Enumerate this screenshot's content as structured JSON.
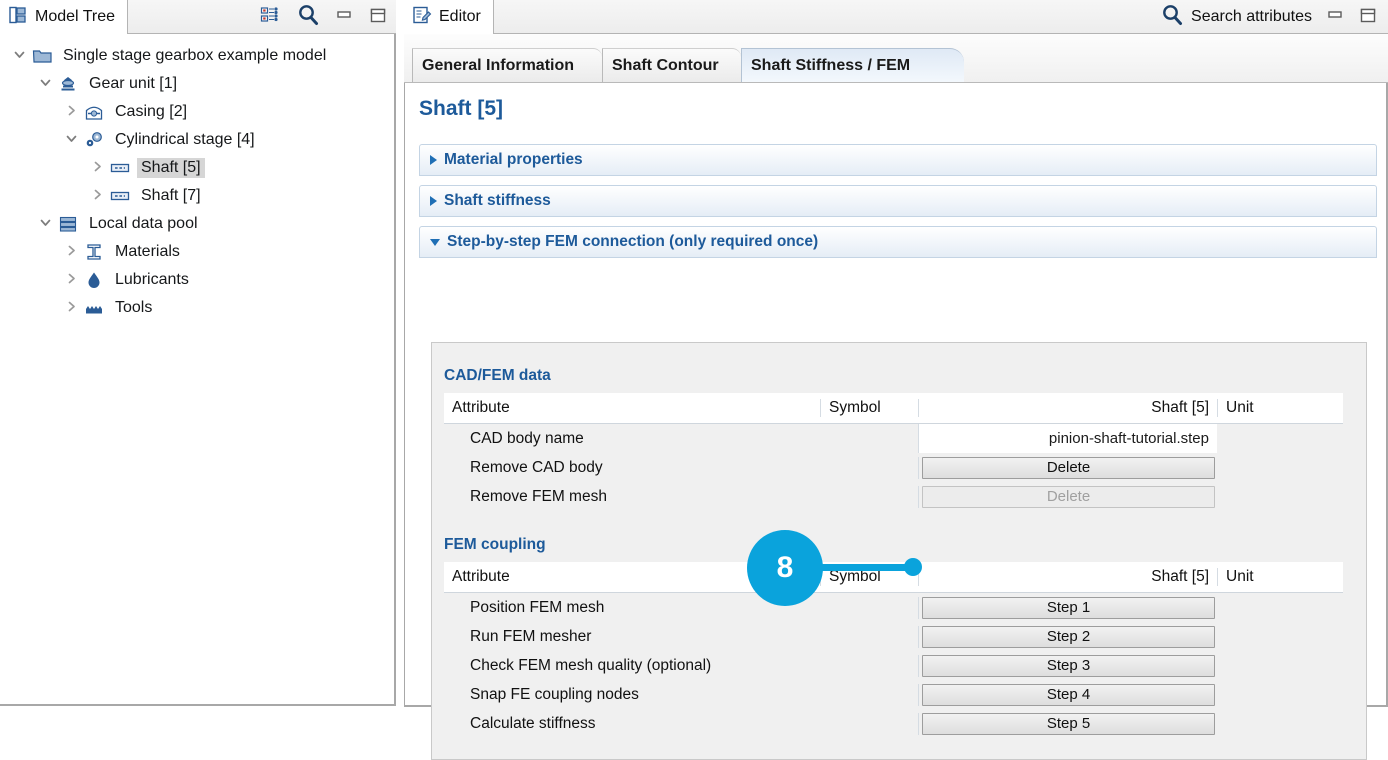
{
  "tree_view": {
    "tab_label": "Model Tree",
    "tab_icon": "model-tree-icon",
    "toolbar": [
      {
        "name": "link-tree-icon",
        "glyph": "link"
      },
      {
        "name": "search-icon",
        "glyph": "search"
      },
      {
        "name": "minimize-icon",
        "glyph": "minimize"
      },
      {
        "name": "maximize-icon",
        "glyph": "maximize"
      }
    ],
    "nodes": [
      {
        "label": "Single stage gearbox example model",
        "indent": 0,
        "twist": "down",
        "icon": "folder-icon",
        "selected": false
      },
      {
        "label": "Gear unit [1]",
        "indent": 1,
        "twist": "down",
        "icon": "gear-unit-icon",
        "selected": false
      },
      {
        "label": "Casing [2]",
        "indent": 2,
        "twist": "right",
        "icon": "casing-icon",
        "selected": false
      },
      {
        "label": "Cylindrical stage [4]",
        "indent": 2,
        "twist": "down",
        "icon": "cylindrical-stage-icon",
        "selected": false
      },
      {
        "label": "Shaft [5]",
        "indent": 3,
        "twist": "right",
        "icon": "shaft-icon",
        "selected": true
      },
      {
        "label": "Shaft [7]",
        "indent": 3,
        "twist": "right",
        "icon": "shaft-icon",
        "selected": false
      },
      {
        "label": "Local data pool",
        "indent": 1,
        "twist": "down",
        "icon": "data-pool-icon",
        "selected": false
      },
      {
        "label": "Materials",
        "indent": 2,
        "twist": "right",
        "icon": "materials-icon",
        "selected": false
      },
      {
        "label": "Lubricants",
        "indent": 2,
        "twist": "right",
        "icon": "lubricants-icon",
        "selected": false
      },
      {
        "label": "Tools",
        "indent": 2,
        "twist": "right",
        "icon": "tools-icon",
        "selected": false
      }
    ]
  },
  "editor": {
    "tab_label": "Editor",
    "tab_icon": "editor-icon",
    "search_label": "Search attributes",
    "search_icon": "search-icon",
    "minimize_icon": "minimize-icon",
    "maximize_icon": "maximize-icon",
    "tabs": [
      {
        "label": "General Information",
        "active": false
      },
      {
        "label": "Shaft Contour",
        "active": false
      },
      {
        "label": "Shaft Stiffness / FEM",
        "active": true
      }
    ],
    "page_title": "Shaft [5]",
    "sections": [
      {
        "label": "Material properties",
        "expanded": false
      },
      {
        "label": "Shaft stiffness",
        "expanded": false
      },
      {
        "label": "Step-by-step FEM connection (only required once)",
        "expanded": true
      }
    ],
    "groups": [
      {
        "title": "CAD/FEM data",
        "headers": {
          "attribute": "Attribute",
          "symbol": "Symbol",
          "value": "Shaft [5]",
          "unit": "Unit"
        },
        "rows": [
          {
            "attribute": "CAD body name",
            "symbol": "",
            "value": "pinion-shaft-tutorial.step",
            "value_kind": "text",
            "unit": "",
            "disabled": false
          },
          {
            "attribute": "Remove CAD body",
            "symbol": "",
            "value": "Delete",
            "value_kind": "button",
            "unit": "",
            "disabled": false
          },
          {
            "attribute": "Remove FEM mesh",
            "symbol": "",
            "value": "Delete",
            "value_kind": "button",
            "unit": "",
            "disabled": true
          }
        ]
      },
      {
        "title": "FEM coupling",
        "headers": {
          "attribute": "Attribute",
          "symbol": "Symbol",
          "value": "Shaft [5]",
          "unit": "Unit"
        },
        "rows": [
          {
            "attribute": "Position FEM mesh",
            "symbol": "",
            "value": "Step 1",
            "value_kind": "button",
            "unit": "",
            "disabled": false
          },
          {
            "attribute": "Run FEM mesher",
            "symbol": "",
            "value": "Step 2",
            "value_kind": "button",
            "unit": "",
            "disabled": false
          },
          {
            "attribute": "Check FEM mesh quality (optional)",
            "symbol": "",
            "value": "Step 3",
            "value_kind": "button",
            "unit": "",
            "disabled": false
          },
          {
            "attribute": "Snap FE coupling nodes",
            "symbol": "",
            "value": "Step 4",
            "value_kind": "button",
            "unit": "",
            "disabled": false
          },
          {
            "attribute": "Calculate stiffness",
            "symbol": "",
            "value": "Step 5",
            "value_kind": "button",
            "unit": "",
            "disabled": false
          }
        ]
      }
    ]
  },
  "callout": {
    "number": "8",
    "color": "#0aa3dc",
    "points_at": "Step 2"
  }
}
